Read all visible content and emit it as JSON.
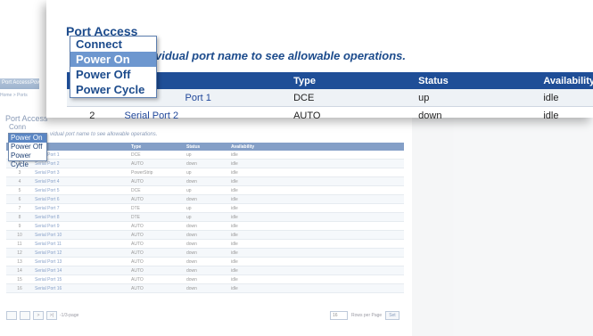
{
  "background": {
    "tabs": [
      "Port Access",
      "Pow"
    ],
    "breadcrumb": "Home > Ports",
    "section_title": "Port Access",
    "connect_label": "Conn",
    "menu": [
      "Power On",
      "Power Off",
      "Power Cycle"
    ],
    "hint": "vidual port name to see allowable operations.",
    "columns": [
      "",
      "Type",
      "Status",
      "Availability"
    ],
    "rows": [
      {
        "num": "1",
        "name": "Serial Port 1",
        "type": "DCE",
        "status": "up",
        "avail": "idle"
      },
      {
        "num": "2",
        "name": "Serial Port 2",
        "type": "AUTO",
        "status": "down",
        "avail": "idle"
      },
      {
        "num": "3",
        "name": "Serial Port 3",
        "type": "PowerStrip",
        "status": "up",
        "avail": "idle"
      },
      {
        "num": "4",
        "name": "Serial Port 4",
        "type": "AUTO",
        "status": "down",
        "avail": "idle"
      },
      {
        "num": "5",
        "name": "Serial Port 5",
        "type": "DCE",
        "status": "up",
        "avail": "idle"
      },
      {
        "num": "6",
        "name": "Serial Port 6",
        "type": "AUTO",
        "status": "down",
        "avail": "idle"
      },
      {
        "num": "7",
        "name": "Serial Port 7",
        "type": "DTE",
        "status": "up",
        "avail": "idle"
      },
      {
        "num": "8",
        "name": "Serial Port 8",
        "type": "DTE",
        "status": "up",
        "avail": "idle"
      },
      {
        "num": "9",
        "name": "Serial Port 9",
        "type": "AUTO",
        "status": "down",
        "avail": "idle"
      },
      {
        "num": "10",
        "name": "Serial Port 10",
        "type": "AUTO",
        "status": "down",
        "avail": "idle"
      },
      {
        "num": "11",
        "name": "Serial Port 11",
        "type": "AUTO",
        "status": "down",
        "avail": "idle"
      },
      {
        "num": "12",
        "name": "Serial Port 12",
        "type": "AUTO",
        "status": "down",
        "avail": "idle"
      },
      {
        "num": "13",
        "name": "Serial Port 13",
        "type": "AUTO",
        "status": "down",
        "avail": "idle"
      },
      {
        "num": "14",
        "name": "Serial Port 14",
        "type": "AUTO",
        "status": "down",
        "avail": "idle"
      },
      {
        "num": "15",
        "name": "Serial Port 15",
        "type": "AUTO",
        "status": "down",
        "avail": "idle"
      },
      {
        "num": "16",
        "name": "Serial Port 16",
        "type": "AUTO",
        "status": "down",
        "avail": "idle"
      }
    ],
    "pager": {
      "btn1": "",
      "btn2": "",
      "btn3": ">",
      "btn4": ">|",
      "page_text": "-1/3-page",
      "rows_value": "16",
      "rows_label": "Rows per Page",
      "set_label": "Set"
    }
  },
  "zoom": {
    "section_title": "Port Access",
    "hint": "vidual port name to see allowable operations.",
    "menu": [
      "Connect",
      "Power On",
      "Power Off",
      "Power Cycle"
    ],
    "columns": [
      "",
      "",
      "Type",
      "Status",
      "Availability"
    ],
    "rows": [
      {
        "num": "",
        "name": "Port 1",
        "type": "DCE",
        "status": "up",
        "avail": "idle"
      },
      {
        "num": "2",
        "name": "Serial Port 2",
        "type": "AUTO",
        "status": "down",
        "avail": "idle"
      }
    ]
  },
  "colors": {
    "header_blue": "#1f4e97",
    "menu_selected": "#6d97cf",
    "link_blue": "#21489a"
  }
}
